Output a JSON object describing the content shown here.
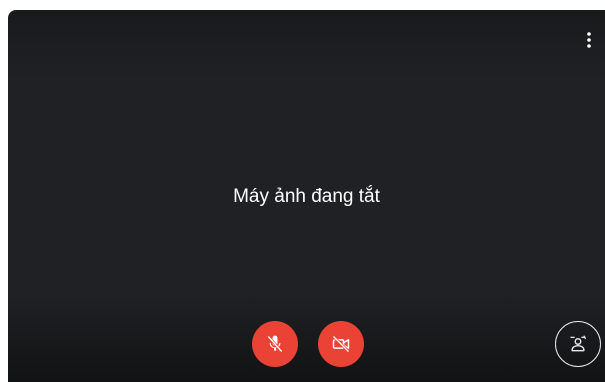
{
  "preview": {
    "status_text": "Máy ảnh đang tắt"
  },
  "controls": {
    "mic": {
      "icon": "mic-off-icon",
      "state": "off"
    },
    "camera": {
      "icon": "videocam-off-icon",
      "state": "off"
    },
    "effects": {
      "icon": "visual-effects-icon"
    }
  },
  "menu": {
    "icon": "more-vert-icon"
  },
  "colors": {
    "background": "#202124",
    "off_button": "#ea4335",
    "text": "#ffffff"
  }
}
